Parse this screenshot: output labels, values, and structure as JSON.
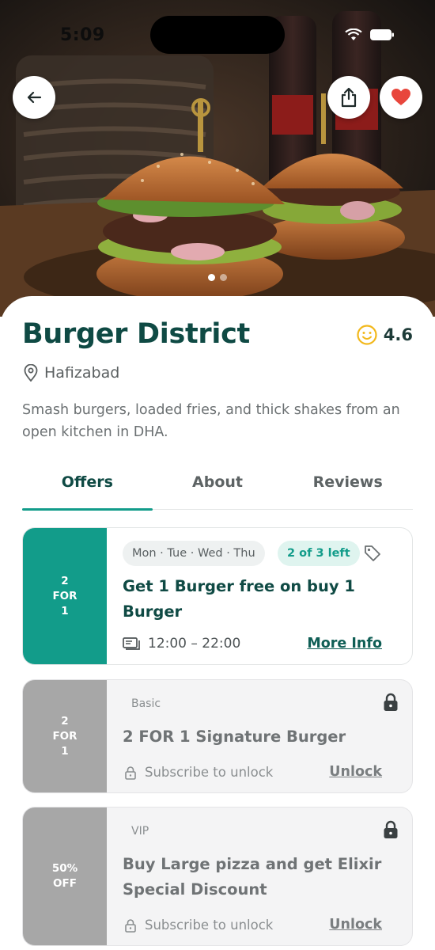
{
  "status_bar": {
    "time": "5:09"
  },
  "hero": {
    "carousel_count": 2,
    "carousel_active": 0
  },
  "restaurant": {
    "name": "Burger District",
    "rating": "4.6",
    "location": "Hafizabad",
    "description": "Smash burgers, loaded fries, and thick shakes from an open kitchen in DHA."
  },
  "tabs": [
    {
      "label": "Offers",
      "active": true
    },
    {
      "label": "About",
      "active": false
    },
    {
      "label": "Reviews",
      "active": false
    }
  ],
  "offers": [
    {
      "badge": [
        "2",
        "FOR",
        "1"
      ],
      "days": "Mon · Tue · Wed · Thu",
      "remaining": "2 of 3 left",
      "title": "Get 1 Burger free on buy 1 Burger",
      "time": "12:00 – 22:00",
      "action": "More Info"
    },
    {
      "badge": [
        "2",
        "FOR",
        "1"
      ],
      "tier": "Basic",
      "title": "2 FOR 1 Signature Burger",
      "sub": "Subscribe to unlock",
      "action": "Unlock"
    },
    {
      "badge": [
        "50%",
        "OFF"
      ],
      "tier": "VIP",
      "title": "Buy Large pizza and get Elixir Special Discount",
      "sub": "Subscribe to unlock",
      "action": "Unlock"
    }
  ],
  "colors": {
    "primary": "#0f4a44",
    "accent": "#129c8a",
    "favorite": "#e8463c",
    "rating_icon": "#f2b81c",
    "locked_badge": "#a7a7a7"
  },
  "icons": {
    "back": "arrow-left",
    "share": "share",
    "favorite": "heart",
    "rating": "smiley",
    "location": "map-pin",
    "tag": "tag",
    "time": "ticket",
    "lock": "lock"
  }
}
